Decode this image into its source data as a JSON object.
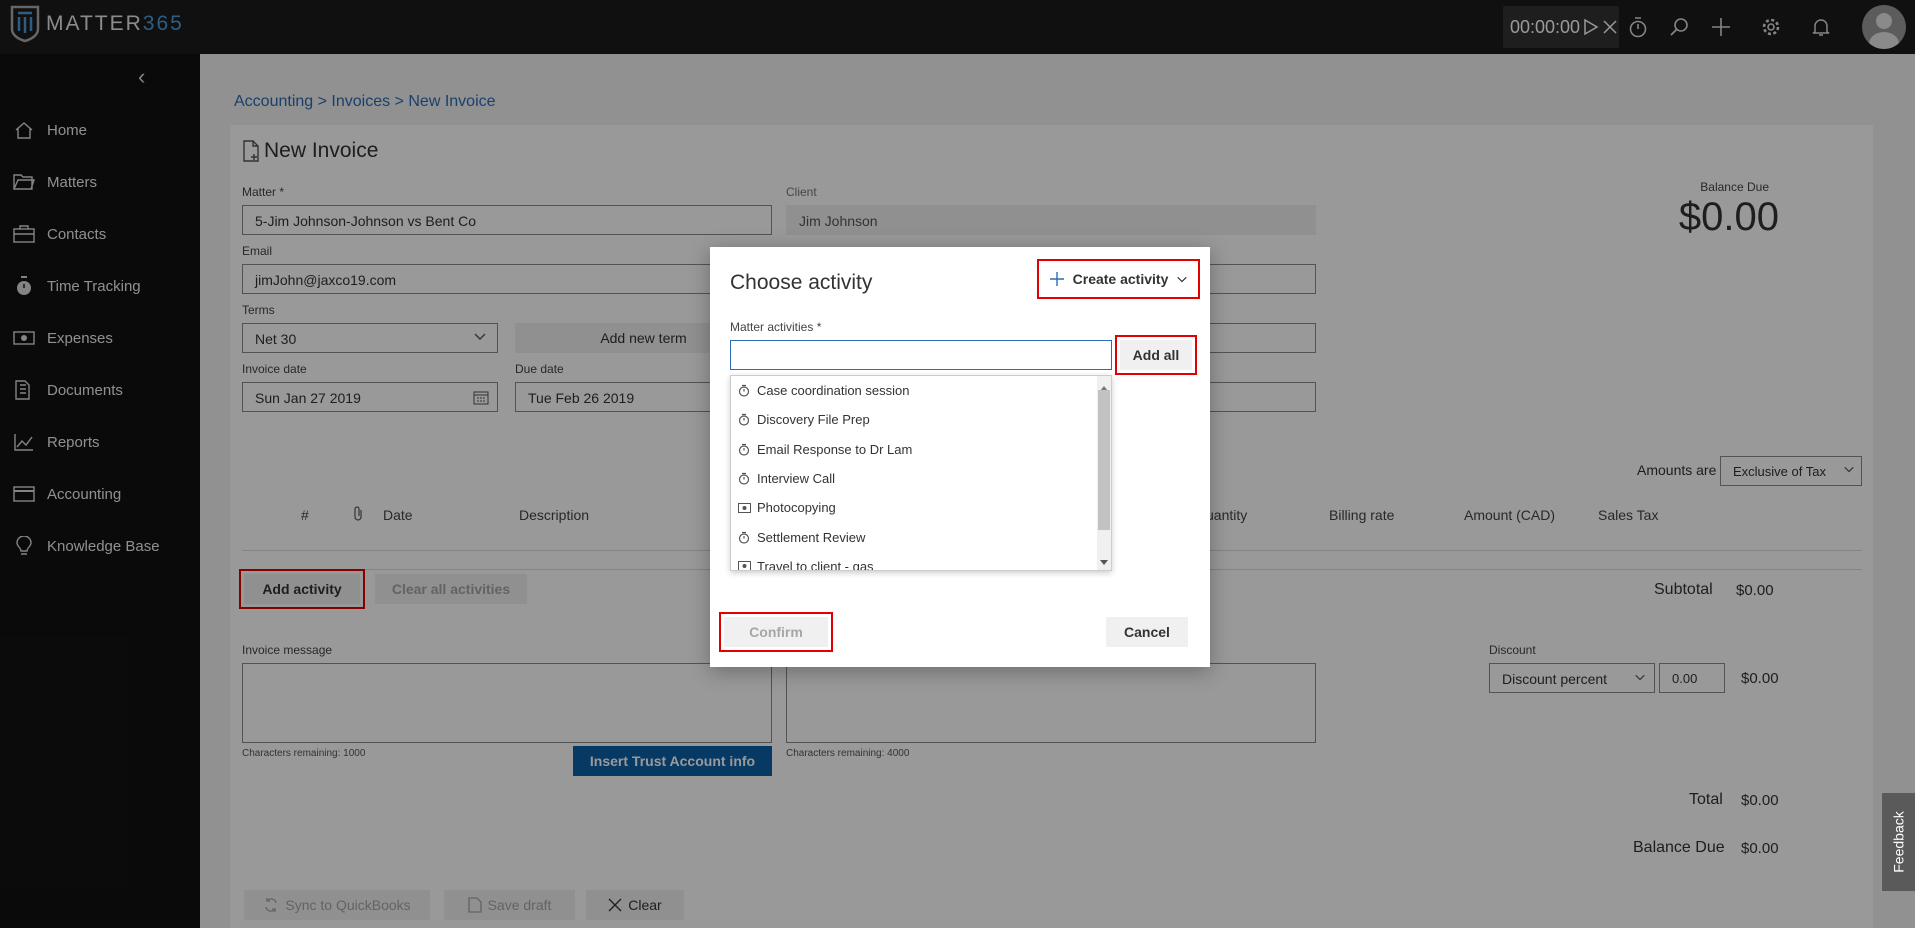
{
  "app": {
    "logo_prefix": "MATTER",
    "logo_suffix": "365"
  },
  "topbar": {
    "timer": "00:00:00"
  },
  "sidebar": {
    "items": [
      {
        "label": "Home",
        "icon": "home-icon"
      },
      {
        "label": "Matters",
        "icon": "folder-icon"
      },
      {
        "label": "Contacts",
        "icon": "contacts-icon"
      },
      {
        "label": "Time Tracking",
        "icon": "stopwatch-icon"
      },
      {
        "label": "Expenses",
        "icon": "money-icon"
      },
      {
        "label": "Documents",
        "icon": "documents-icon"
      },
      {
        "label": "Reports",
        "icon": "chart-icon"
      },
      {
        "label": "Accounting",
        "icon": "card-icon"
      },
      {
        "label": "Knowledge Base",
        "icon": "lightbulb-icon"
      }
    ]
  },
  "breadcrumb": {
    "part1": "Accounting",
    "sep": ">",
    "part2": "Invoices",
    "part3": "New Invoice"
  },
  "invoice": {
    "title": "New Invoice",
    "matter_label": "Matter *",
    "matter_value": "5-Jim Johnson-Johnson vs Bent Co",
    "client_label": "Client",
    "client_value": "Jim Johnson",
    "email_label": "Email",
    "email_value": "jimJohn@jaxco19.com",
    "terms_label": "Terms",
    "terms_value": "Net 30",
    "add_term": "Add new term",
    "invoice_date_label": "Invoice date",
    "invoice_date_value": "Sun Jan 27 2019",
    "due_date_label": "Due date",
    "due_date_value": "Tue Feb 26 2019",
    "balance_due_label": "Balance Due",
    "balance_due_value": "$0.00",
    "amounts_label": "Amounts are",
    "amounts_value": "Exclusive of Tax",
    "columns": {
      "num": "#",
      "date": "Date",
      "description": "Description",
      "quantity": "uantity",
      "billing_rate": "Billing rate",
      "amount": "Amount (CAD)",
      "sales_tax": "Sales Tax"
    },
    "add_activity": "Add activity",
    "clear_all": "Clear all activities",
    "subtotal_label": "Subtotal",
    "subtotal_value": "$0.00",
    "invoice_message_label": "Invoice message",
    "chars_remaining_1": "Characters remaining: 1000",
    "chars_remaining_2": "Characters remaining: 4000",
    "insert_trust": "Insert Trust Account info",
    "discount_label": "Discount",
    "discount_type": "Discount percent",
    "discount_value": "0.00",
    "discount_amount": "$0.00",
    "total_label": "Total",
    "total_value": "$0.00",
    "balance_label": "Balance Due",
    "balance_value": "$0.00",
    "sync": "Sync to QuickBooks",
    "save_draft": "Save draft",
    "clear": "Clear"
  },
  "modal": {
    "title": "Choose activity",
    "create_activity": "Create activity",
    "matter_activities_label": "Matter activities *",
    "search_value": "",
    "add_all": "Add all",
    "activities": [
      {
        "label": "Case coordination session",
        "icon": "stopwatch-icon"
      },
      {
        "label": "Discovery File Prep",
        "icon": "stopwatch-icon"
      },
      {
        "label": "Email Response to Dr Lam",
        "icon": "stopwatch-icon"
      },
      {
        "label": "Interview Call",
        "icon": "stopwatch-icon"
      },
      {
        "label": "Photocopying",
        "icon": "money-icon"
      },
      {
        "label": "Settlement Review",
        "icon": "stopwatch-icon"
      },
      {
        "label": "Travel to client - gas",
        "icon": "money-icon"
      }
    ],
    "confirm": "Confirm",
    "cancel": "Cancel"
  },
  "feedback": "Feedback"
}
